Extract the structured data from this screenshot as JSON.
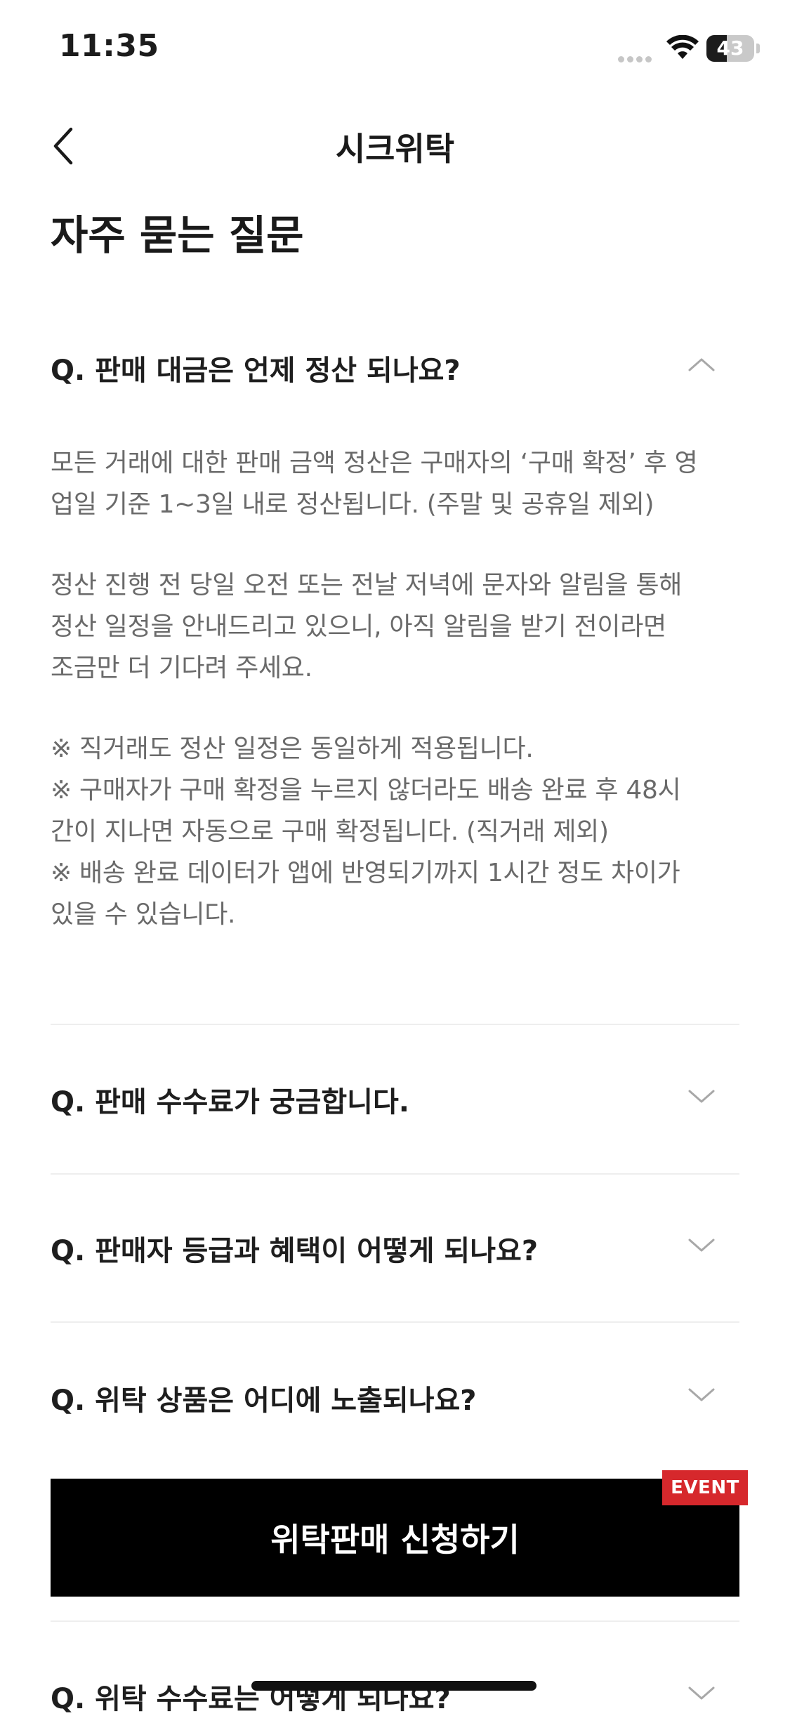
{
  "status_bar": {
    "time": "11:35",
    "battery": "43",
    "battery_level": 0.43
  },
  "nav": {
    "title": "시크위탁",
    "back_icon": "chevron-left-icon"
  },
  "page": {
    "title": "자주 묻는 질문"
  },
  "faq": [
    {
      "question": "Q.  판매 대금은 언제 정산 되나요?",
      "expanded": true,
      "answer": [
        "모든 거래에 대한 판매 금액 정산은 구매자의 ‘구매 확정’ 후 영",
        "업일 기준 1~3일 내로 정산됩니다. (주말 및 공휴일 제외)",
        "정산 진행 전 당일 오전 또는 전날 저녁에 문자와 알림을 통해",
        "정산 일정을 안내드리고 있으니, 아직 알림을 받기 전이라면",
        "조금만 더 기다려 주세요.",
        "※ 직거래도 정산 일정은 동일하게 적용됩니다.",
        "※ 구매자가 구매 확정을 누르지 않더라도 배송 완료 후 48시",
        "간이 지나면 자동으로 구매 확정됩니다. (직거래 제외)",
        "※ 배송 완료 데이터가 앱에 반영되기까지 1시간 정도 차이가",
        "있을 수 있습니다."
      ]
    },
    {
      "question": "Q.  판매 수수료가 궁금합니다.",
      "expanded": false
    },
    {
      "question": "Q.  판매자 등급과 혜택이 어떻게 되나요?",
      "expanded": false
    },
    {
      "question": "Q.  위탁 상품은 어디에 노출되나요?",
      "expanded": false
    },
    {
      "question": "Q.  위탁 수수료는 어떻게 되나요?",
      "expanded": false
    }
  ],
  "cta": {
    "label": "위탁판매 신청하기",
    "badge": "EVENT",
    "badge_color": "#d6282c"
  },
  "colors": {
    "text": "#1c1c1c",
    "answer_text": "#6a6a6a",
    "divider": "#eeeeee",
    "button_bg": "#000000"
  }
}
